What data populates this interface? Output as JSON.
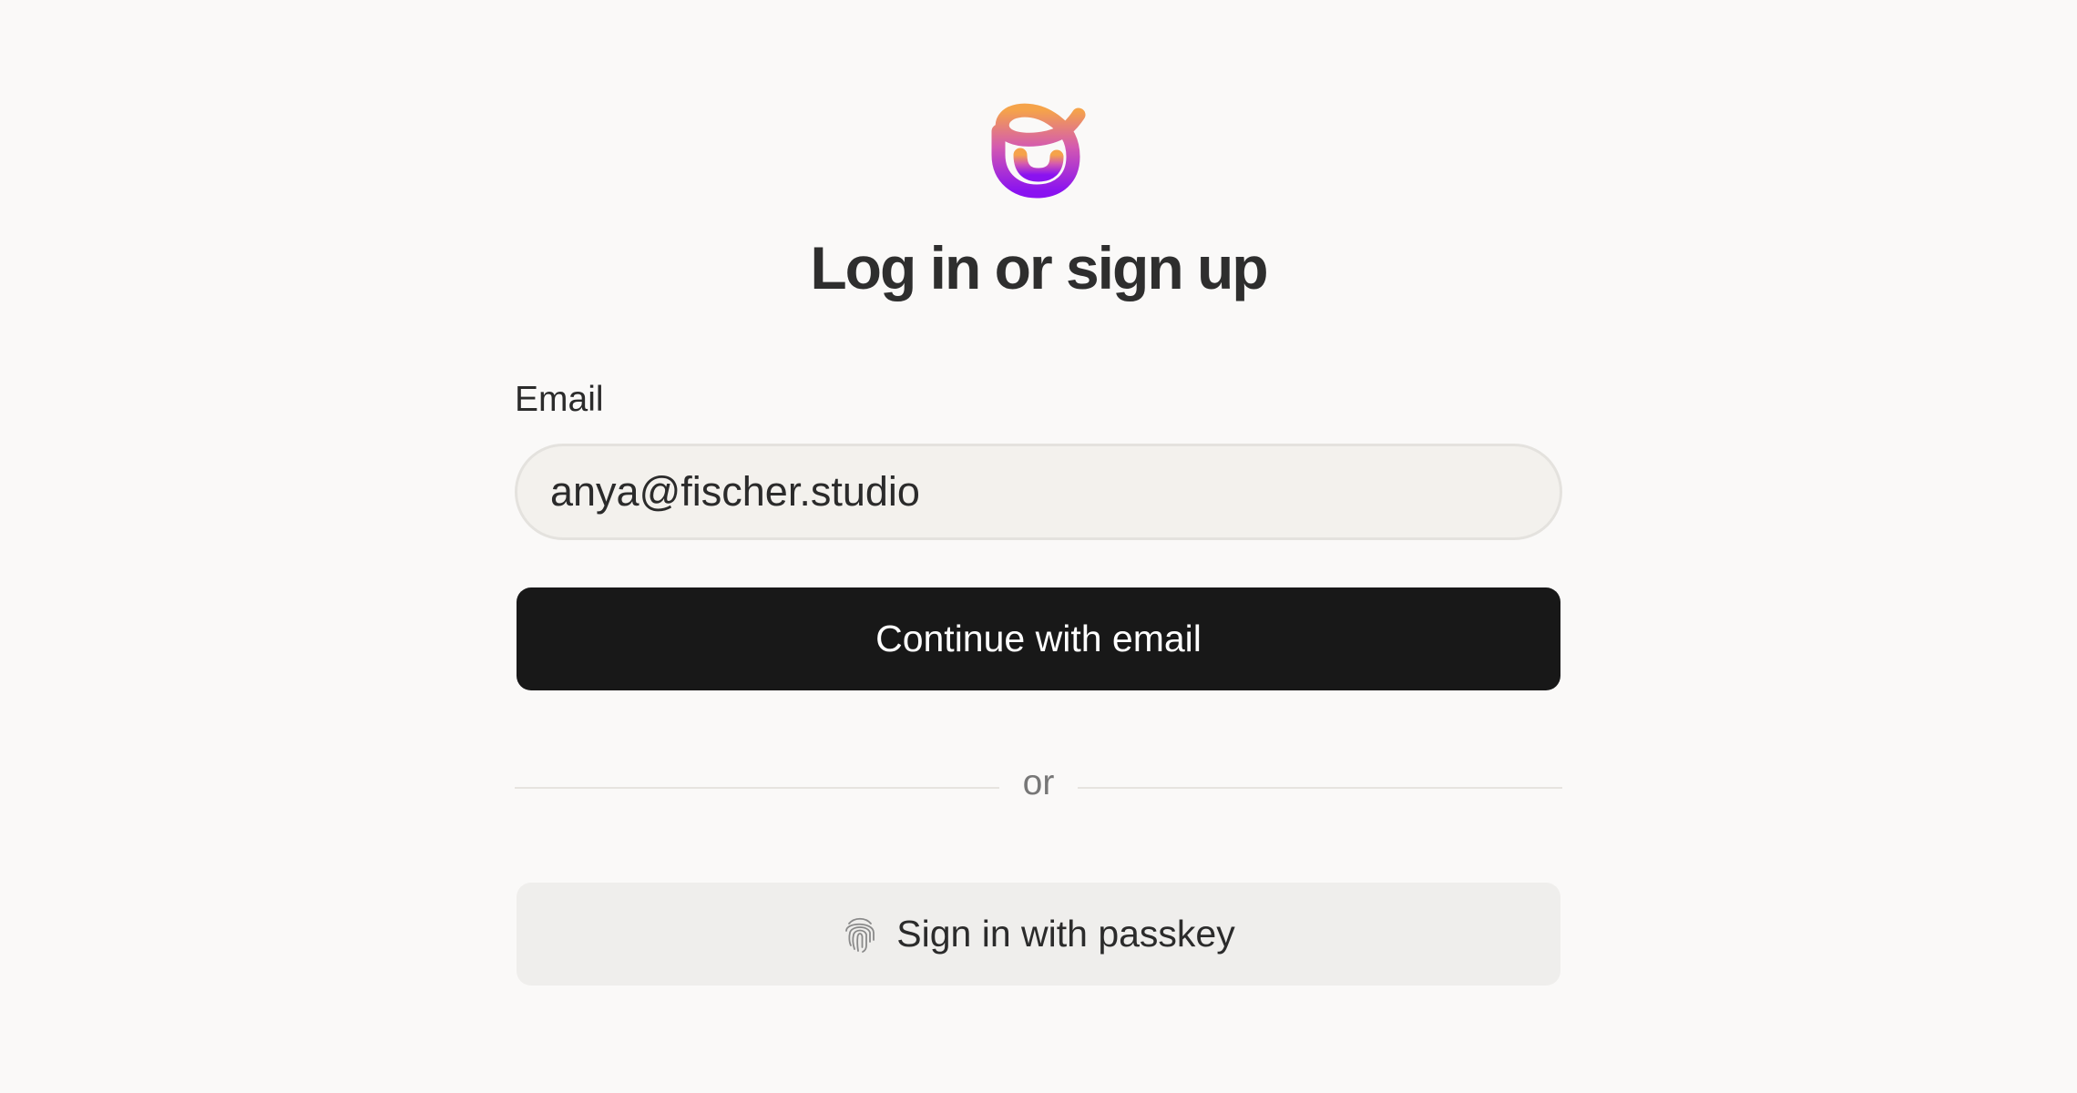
{
  "brand": {
    "logo_icon": "looped-ribbon-logo",
    "gradient_start": "#f5a34a",
    "gradient_end": "#8a12f0"
  },
  "auth": {
    "title": "Log in or sign up",
    "email_label": "Email",
    "email_value": "anya@fischer.studio",
    "continue_label": "Continue with email",
    "divider_text": "or",
    "passkey_label": "Sign in with passkey",
    "passkey_icon": "fingerprint-icon"
  },
  "colors": {
    "background": "#faf9f8",
    "primary_button": "#181818",
    "secondary_button": "#efeeec",
    "input_background": "#f3f1ed"
  }
}
